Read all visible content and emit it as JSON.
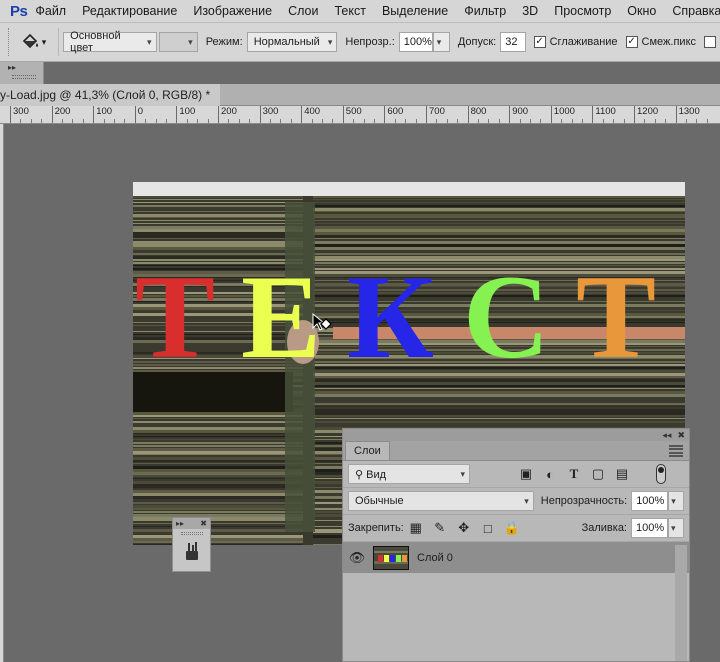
{
  "app": {
    "logo": "Ps"
  },
  "menu": [
    "Файл",
    "Редактирование",
    "Изображение",
    "Слои",
    "Текст",
    "Выделение",
    "Фильтр",
    "3D",
    "Просмотр",
    "Окно",
    "Справка"
  ],
  "options": {
    "fill_source": "Основной цвет",
    "mode_label": "Режим:",
    "mode_value": "Нормальный",
    "opacity_label": "Непрозр.:",
    "opacity_value": "100%",
    "tolerance_label": "Допуск:",
    "tolerance_value": "32",
    "antialias_label": "Сглаживание",
    "contiguous_label": "Смеж.пикс"
  },
  "document": {
    "tab_title": "y-Load.jpg @ 41,3% (Слой 0, RGB/8) *"
  },
  "ruler": {
    "labels": [
      "300",
      "200",
      "100",
      "0",
      "100",
      "200",
      "300",
      "400",
      "500",
      "600",
      "700",
      "800",
      "900",
      "1000",
      "1100",
      "1200",
      "1300"
    ]
  },
  "canvas_text": {
    "letters": [
      {
        "char": "Т",
        "color": "#d82e2e"
      },
      {
        "char": "Е",
        "color": "#eaff50"
      },
      {
        "char": "К",
        "color": "#2626e8"
      },
      {
        "char": "С",
        "color": "#86f252"
      },
      {
        "char": "Т",
        "color": "#e8973a"
      }
    ]
  },
  "layers_panel": {
    "tab_label": "Слои",
    "filter_label": "Вид",
    "blend_mode": "Обычные",
    "opacity_label": "Непрозрачность:",
    "opacity_value": "100%",
    "lock_label": "Закрепить:",
    "fill_label": "Заливка:",
    "fill_value": "100%",
    "layers": [
      {
        "name": "Слой 0",
        "visible": true
      }
    ]
  }
}
